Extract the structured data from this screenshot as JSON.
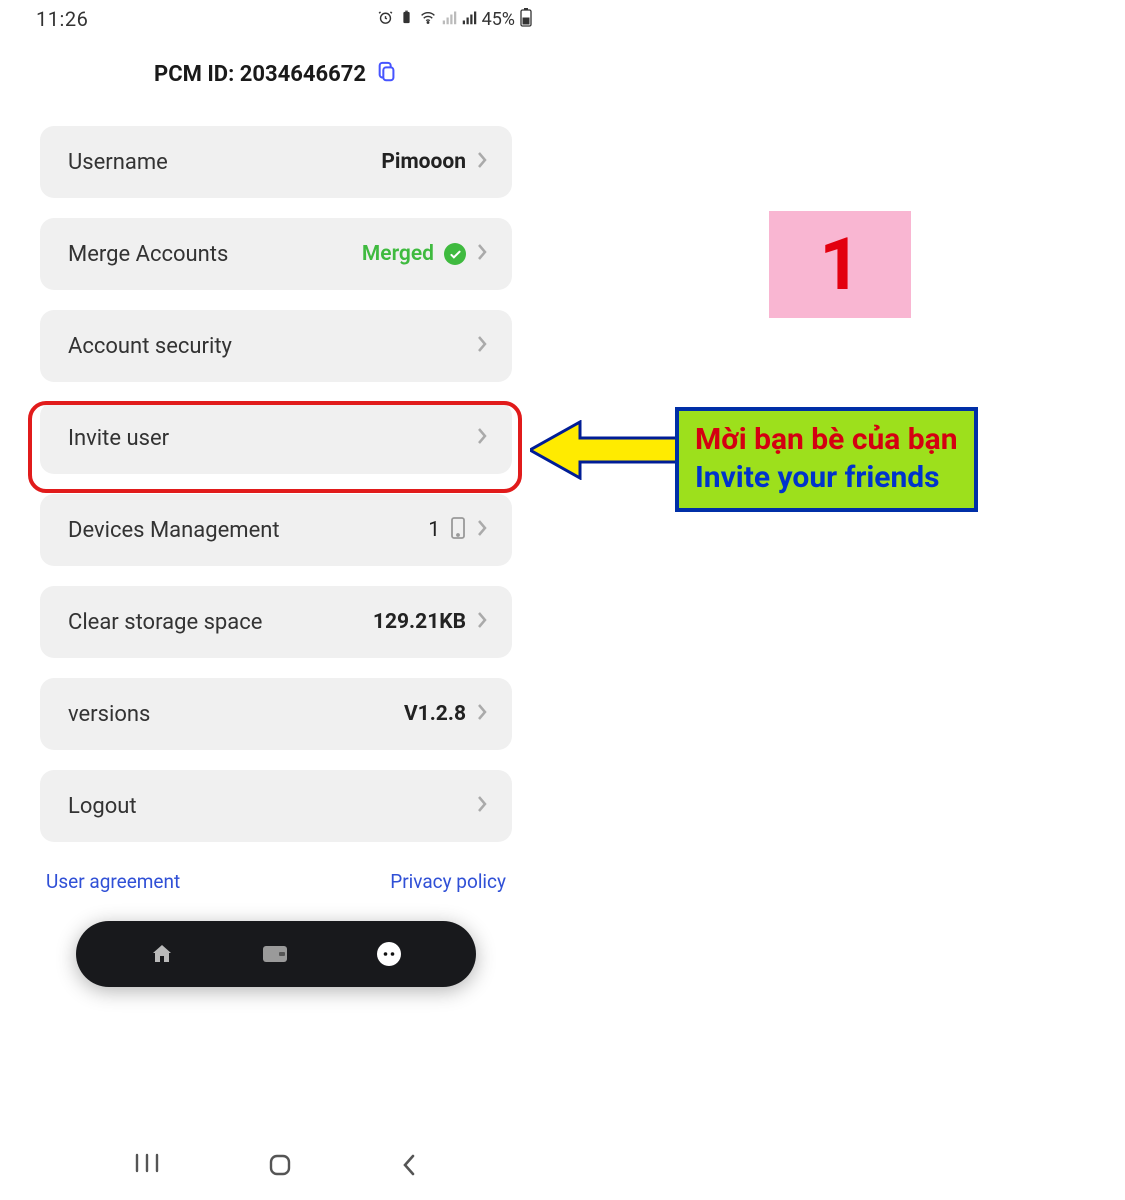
{
  "status": {
    "time": "11:26",
    "battery_text": "45%"
  },
  "header": {
    "pcm_label": "PCM ID:",
    "pcm_id": "2034646672"
  },
  "menu": {
    "username": {
      "label": "Username",
      "value": "Pimooon"
    },
    "merge": {
      "label": "Merge Accounts",
      "value": "Merged"
    },
    "security": {
      "label": "Account security"
    },
    "invite": {
      "label": "Invite user"
    },
    "devices": {
      "label": "Devices Management",
      "value": "1"
    },
    "storage": {
      "label": "Clear storage space",
      "value": "129.21KB"
    },
    "versions": {
      "label": "versions",
      "value": "V1.2.8"
    },
    "logout": {
      "label": "Logout"
    }
  },
  "footer": {
    "user_agreement": "User agreement",
    "privacy_policy": "Privacy policy"
  },
  "annotations": {
    "step_number": "1",
    "callout_line1": "Mời bạn bè của bạn",
    "callout_line2": "Invite your friends"
  }
}
